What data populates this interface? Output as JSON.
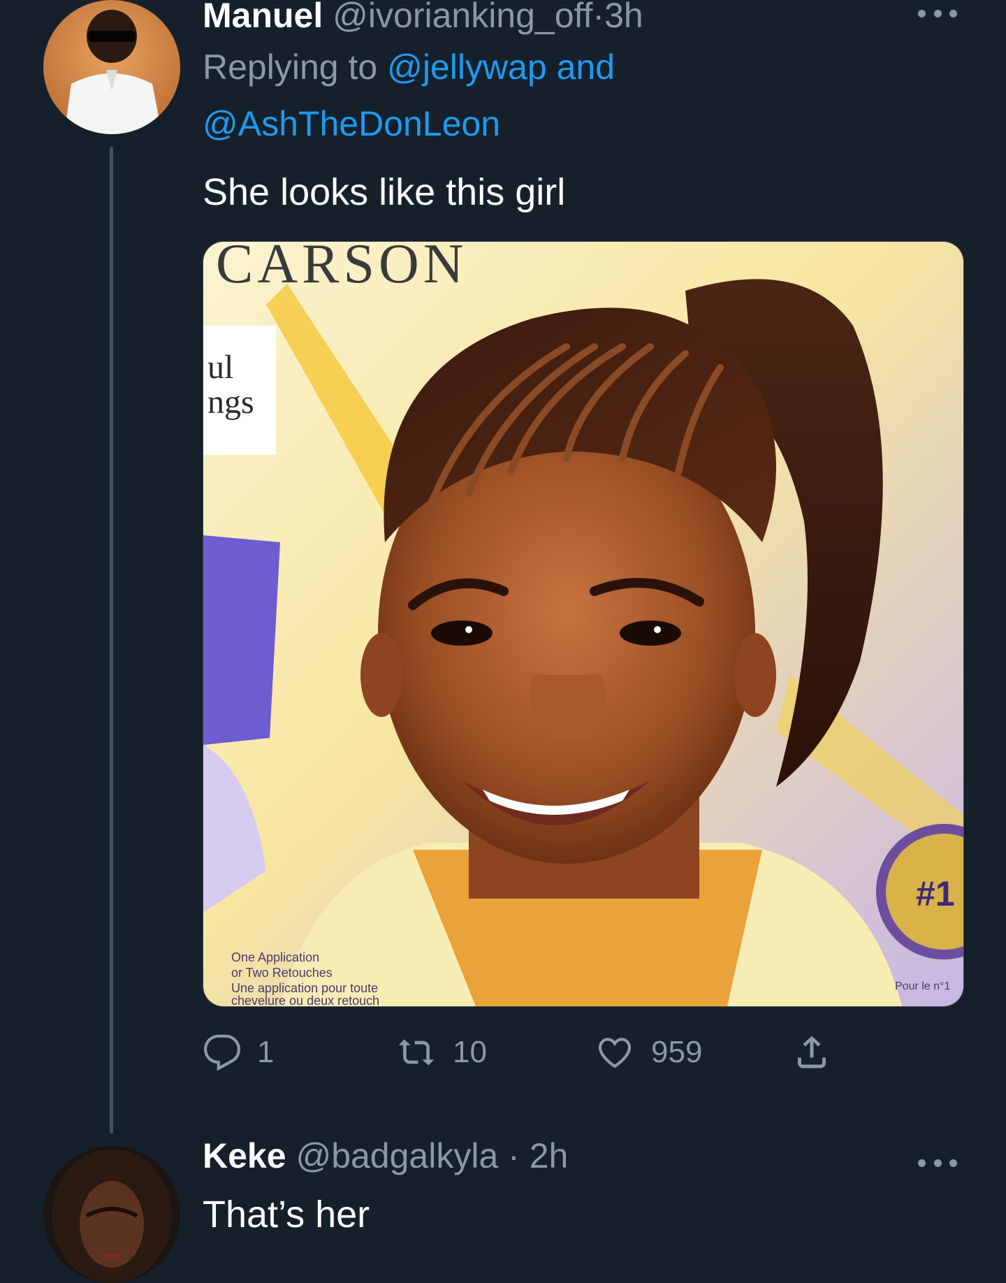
{
  "tweet1": {
    "name": "Manuel",
    "handle": "@ivorianking_off",
    "separator": "·",
    "time": "3h",
    "replying_prefix": "Replying to",
    "replying_user1": "@jellywap",
    "replying_and": "and",
    "replying_user2": "@AshTheDonLeon",
    "text": "She looks like this girl",
    "media": {
      "brand_text": "CARSON",
      "side_text_1": "ul",
      "side_text_2": "ngs",
      "small_text": [
        "One Application",
        "or Two Retouches",
        "Une application pour toute",
        "chevelure ou deux retouch"
      ],
      "badge_text": "#1",
      "corner_text": "Pour le n°1"
    },
    "replies": "1",
    "retweets": "10",
    "likes": "959"
  },
  "tweet2": {
    "name": "Keke",
    "handle": "@badgalkyla",
    "separator": "·",
    "time": "2h",
    "text": "That’s her"
  },
  "colors": {
    "background": "#15202b",
    "accent": "#1d9bf0",
    "secondary_text": "#8b98a5",
    "thread_line": "#3d5466"
  },
  "icons": [
    "reply-icon",
    "retweet-icon",
    "like-icon",
    "share-icon",
    "more-icon"
  ]
}
